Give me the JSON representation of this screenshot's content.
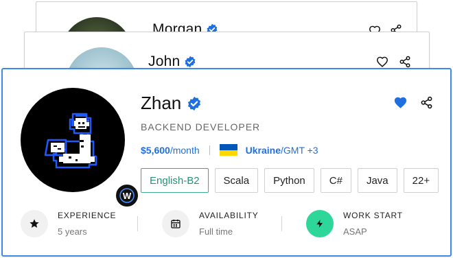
{
  "cards_behind": [
    {
      "name": "Morgan"
    },
    {
      "name": "John"
    }
  ],
  "profile": {
    "name": "Zhan",
    "role": "BACKEND DEVELOPER",
    "price": "$5,600",
    "per": "/month",
    "country": "Ukraine",
    "timezone": "/GMT +3",
    "badge_letter": "W",
    "favorited": true
  },
  "tags": [
    {
      "label": "English-B2",
      "type": "language"
    },
    {
      "label": "Scala",
      "type": "skill"
    },
    {
      "label": "Python",
      "type": "skill"
    },
    {
      "label": "C#",
      "type": "skill"
    },
    {
      "label": "Java",
      "type": "skill"
    },
    {
      "label": "22+",
      "type": "more"
    }
  ],
  "stats": [
    {
      "label": "EXPERIENCE",
      "value": "5 years",
      "icon": "star-icon"
    },
    {
      "label": "AVAILABILITY",
      "value": "Full time",
      "icon": "calendar-icon"
    },
    {
      "label": "WORK START",
      "value": "ASAP",
      "icon": "lightning-icon"
    }
  ],
  "colors": {
    "accent_blue": "#1e6fe0",
    "card_border": "#3b8ae6",
    "language_tag": "#3aa98f",
    "work_start_green": "#2fd69a",
    "flag_blue": "#0057b7",
    "flag_yellow": "#ffd700"
  }
}
